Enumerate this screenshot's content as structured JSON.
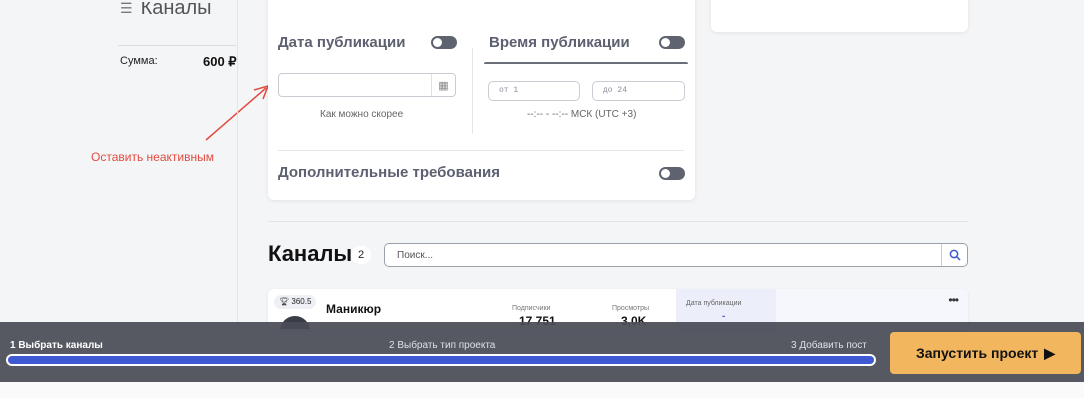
{
  "left": {
    "title": "Каналы",
    "sum_label": "Сумма:",
    "sum_value": "600 ₽",
    "note": "Оставить неактивным"
  },
  "publication": {
    "date_header": "Дата публикации",
    "date_value": "",
    "asap_text": "Как можно скорее",
    "time_header": "Время публикации",
    "from_placeholder": "от 1",
    "to_placeholder": "до 24",
    "time_text": "--:-- - --:-- МСК (UTC +3)",
    "extra_header": "Дополнительные требования"
  },
  "channels": {
    "title": "Каналы",
    "count": "2",
    "search_placeholder": "Поиск...",
    "rows": [
      {
        "rating": "360.5",
        "name": "Маникюр",
        "subscribers_label": "Подписчики",
        "subscribers": "17 751",
        "views_label": "Просмотры",
        "views": "3,0K",
        "pub_date_label": "Дата публикации",
        "pub_date_value": "-"
      }
    ]
  },
  "footer": {
    "step1": "1 Выбрать каналы",
    "step2": "2 Выбрать тип проекта",
    "step3": "3 Добавить пост",
    "progress": 1.0,
    "launch_label": "Запустить проект"
  },
  "colors": {
    "accent": "#3e59d1",
    "launch": "#f2b65e",
    "note": "#e24a3f"
  }
}
